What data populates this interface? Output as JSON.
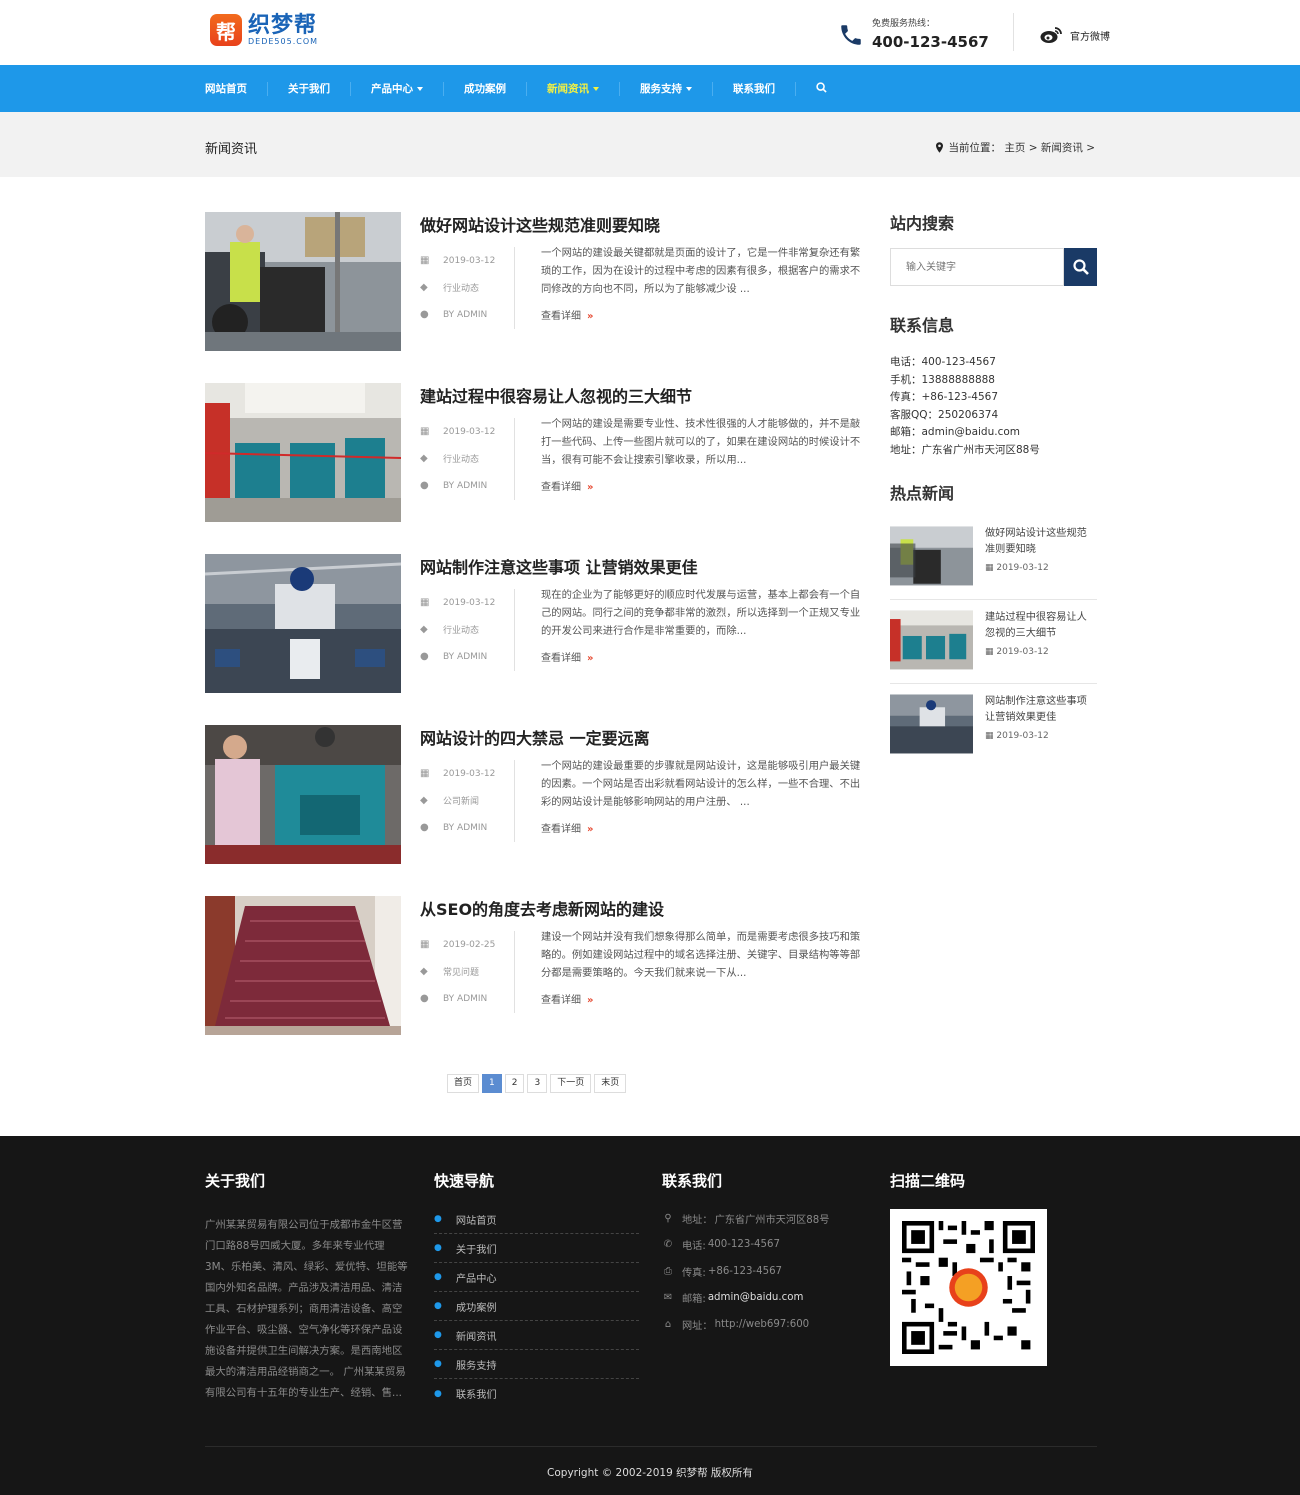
{
  "header": {
    "logo_char": "帮",
    "logo_name": "织梦帮",
    "logo_domain": "DEDE505.COM",
    "hotline_label": "免费服务热线：",
    "hotline_number": "400-123-4567",
    "weibo_label": "官方微博"
  },
  "nav": {
    "items": [
      {
        "label": "网站首页"
      },
      {
        "label": "关于我们"
      },
      {
        "label": "产品中心"
      },
      {
        "label": "成功案例"
      },
      {
        "label": "新闻资讯"
      },
      {
        "label": "服务支持"
      },
      {
        "label": "联系我们"
      }
    ],
    "active_color": "#f4f142",
    "bar_color": "#1e98e9"
  },
  "crumb": {
    "title": "新闻资讯",
    "path": "当前位置： 主页 > 新闻资讯 >"
  },
  "articles": [
    {
      "title": "做好网站设计这些规范准则要知晓",
      "date": "2019-03-12",
      "category": "行业动态",
      "author": "BY ADMIN",
      "excerpt": "一个网站的建设最关键都就是页面的设计了，它是一件非常复杂还有繁琐的工作，因为在设计的过程中考虑的因素有很多，根据客户的需求不同修改的方向也不同，所以为了能够减少设 ...",
      "more": "查看详细"
    },
    {
      "title": "建站过程中很容易让人忽视的三大细节",
      "date": "2019-03-12",
      "category": "行业动态",
      "author": "BY ADMIN",
      "excerpt": "一个网站的建设是需要专业性、技术性很强的人才能够做的，并不是敲打一些代码、上传一些图片就可以的了，如果在建设网站的时候设计不当，很有可能不会让搜索引擎收录，所以用...",
      "more": "查看详细"
    },
    {
      "title": "网站制作注意这些事项 让营销效果更佳",
      "date": "2019-03-12",
      "category": "行业动态",
      "author": "BY ADMIN",
      "excerpt": "现在的企业为了能够更好的顺应时代发展与运营，基本上都会有一个自己的网站。同行之间的竞争都非常的激烈，所以选择到一个正规又专业的开发公司来进行合作是非常重要的，而除...",
      "more": "查看详细"
    },
    {
      "title": "网站设计的四大禁忌 一定要远离",
      "date": "2019-03-12",
      "category": "公司新闻",
      "author": "BY ADMIN",
      "excerpt": "一个网站的建设最重要的步骤就是网站设计，这是能够吸引用户最关键的因素。一个网站是否出彩就看网站设计的怎么样，一些不合理、不出彩的网站设计是能够影响网站的用户注册、 ...",
      "more": "查看详细"
    },
    {
      "title": "从SEO的角度去考虑新网站的建设",
      "date": "2019-02-25",
      "category": "常见问题",
      "author": "BY ADMIN",
      "excerpt": "建设一个网站并没有我们想象得那么简单，而是需要考虑很多技巧和策略的。例如建设网站过程中的域名选择注册、关键字、目录结构等等部分都是需要策略的。今天我们就来说一下从...",
      "more": "查看详细"
    }
  ],
  "pager": {
    "first": "首页",
    "pages": [
      "1",
      "2",
      "3"
    ],
    "current": "1",
    "next": "下一页",
    "last": "末页"
  },
  "sidebar": {
    "search_title": "站内搜索",
    "search_placeholder": "输入关键字",
    "contact_title": "联系信息",
    "contact": [
      "电话：400-123-4567",
      "手机：13888888888",
      "传真：+86-123-4567",
      "客服QQ：250206374",
      "邮箱：admin@baidu.com",
      "地址：广东省广州市天河区88号"
    ],
    "hot_title": "热点新闻",
    "hot": [
      {
        "title": "做好网站设计这些规范准则要知晓",
        "date": "2019-03-12"
      },
      {
        "title": "建站过程中很容易让人忽视的三大细节",
        "date": "2019-03-12"
      },
      {
        "title": "网站制作注意这些事项 让营销效果更佳",
        "date": "2019-03-12"
      }
    ]
  },
  "footer": {
    "about_title": "关于我们",
    "about_text": "广州某某贸易有限公司位于成都市金牛区营门口路88号四威大厦。多年来专业代理3M、乐柏美、清风、绿彩、爱优特、坦能等国内外知名品牌。产品涉及清洁用品、清洁工具、石材护理系列；商用清洁设备、高空作业平台、吸尘器、空气净化等环保产品设施设备并提供卫生间解决方案。是西南地区最大的清洁用品经销商之一。 广州某某贸易有限公司有十五年的专业生产、经销、售...",
    "nav_title": "快速导航",
    "nav_items": [
      "网站首页",
      "关于我们",
      "产品中心",
      "成功案例",
      "新闻资讯",
      "服务支持",
      "联系我们"
    ],
    "contact_title": "联系我们",
    "contact": [
      {
        "label": "地址：",
        "value": "广东省广州市天河区88号"
      },
      {
        "label": "电话:",
        "value": "400-123-4567"
      },
      {
        "label": "传真:",
        "value": "+86-123-4567"
      },
      {
        "label": "邮箱:",
        "value": "admin@baidu.com"
      },
      {
        "label": "网址：",
        "value": "http://web697:600"
      }
    ],
    "qr_title": "扫描二维码",
    "copyright": "Copyright © 2002-2019 织梦帮 版权所有"
  }
}
